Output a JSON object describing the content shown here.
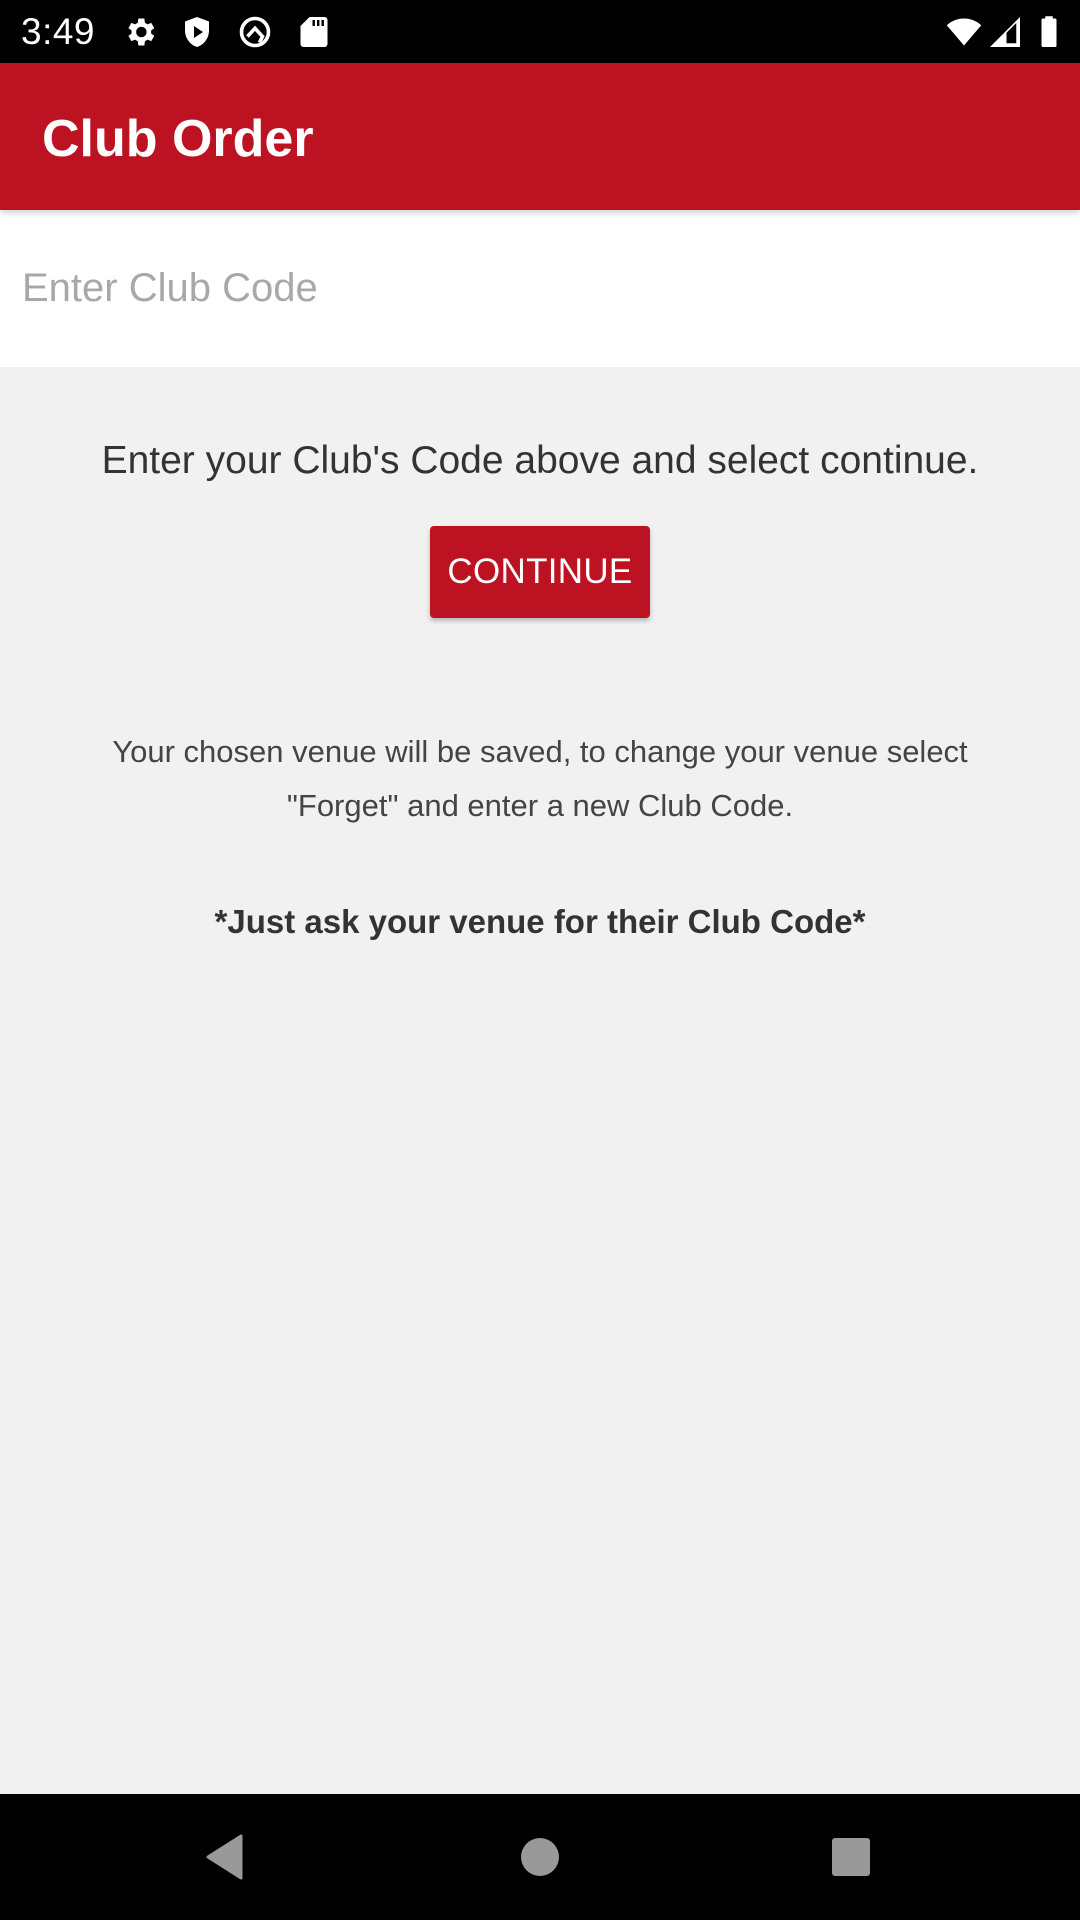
{
  "status_bar": {
    "time": "3:49",
    "left_icons": [
      "settings-gear-icon",
      "play-protect-shield-icon",
      "android-q-icon",
      "sd-card-icon"
    ],
    "right_icons": [
      "wifi-icon",
      "cellular-signal-icon",
      "battery-icon"
    ]
  },
  "app_bar": {
    "title": "Club Order",
    "color": "#bc1222"
  },
  "club_code_field": {
    "value": "",
    "placeholder": "Enter Club Code"
  },
  "main": {
    "instruction": "Enter your Club's Code above and select continue.",
    "continue_label": "CONTINUE",
    "note": "Your chosen venue will be saved, to change your venue select \"Forget\" and enter a new Club Code.",
    "tip": "*Just ask your venue for their Club Code*"
  },
  "nav_bar": {
    "buttons": [
      "back",
      "home",
      "recents"
    ]
  }
}
